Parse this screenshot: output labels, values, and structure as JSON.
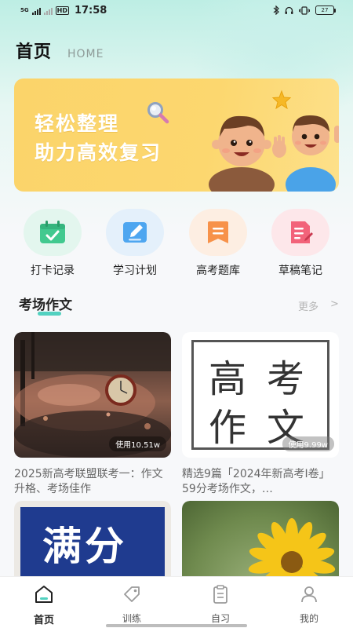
{
  "status_bar": {
    "network": "5G",
    "hd": "HD",
    "time": "17:58",
    "battery": "27"
  },
  "header": {
    "title": "首页",
    "subtitle": "HOME"
  },
  "banner": {
    "line1": "轻松整理",
    "line2": "助力高效复习"
  },
  "quick_actions": [
    {
      "label": "打卡记录",
      "icon": "calendar-check-icon",
      "bg": "#e3f6ee",
      "color": "#42c98f"
    },
    {
      "label": "学习计划",
      "icon": "pencil-board-icon",
      "bg": "#e4f0fb",
      "color": "#4ea6f0"
    },
    {
      "label": "高考题库",
      "icon": "bookmark-list-icon",
      "bg": "#fdeee2",
      "color": "#f7924a"
    },
    {
      "label": "草稿笔记",
      "icon": "note-pen-icon",
      "bg": "#fde7ea",
      "color": "#f2637a"
    }
  ],
  "section": {
    "title": "考场作文",
    "more": "更多",
    "more_chevron": ">"
  },
  "cards": [
    {
      "uses": "使用10.51w",
      "caption": "2025新高考联盟联考一：作文升格、考场佳作"
    },
    {
      "uses": "使用9.99w",
      "caption": "精选9篇「2024年新高考Ⅰ卷」59分考场作文，…",
      "img_text": [
        "高",
        "考",
        "作",
        "文"
      ]
    },
    {
      "img_text": "满分"
    },
    {}
  ],
  "tabs": [
    {
      "label": "首页",
      "icon": "home-icon",
      "active": true
    },
    {
      "label": "训练",
      "icon": "tag-icon",
      "active": false
    },
    {
      "label": "自习",
      "icon": "clipboard-icon",
      "active": false
    },
    {
      "label": "我的",
      "icon": "user-icon",
      "active": false
    }
  ]
}
